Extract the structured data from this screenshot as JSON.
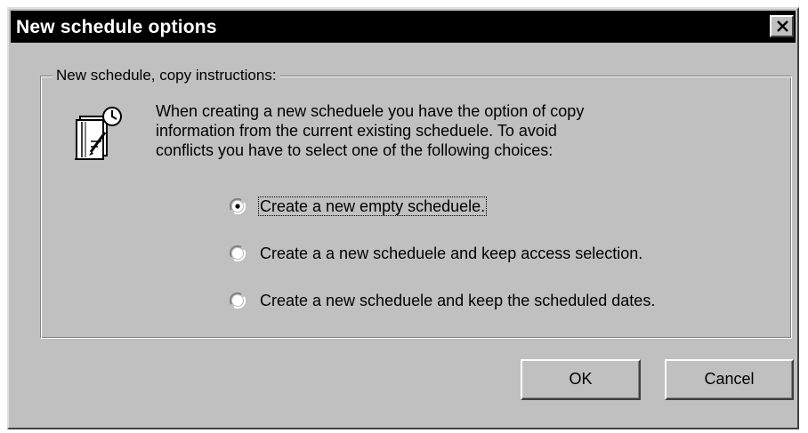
{
  "window": {
    "title": "New schedule options",
    "close_icon": "close-icon"
  },
  "group": {
    "legend": "New schedule, copy instructions:",
    "icon": "schedule-book-icon",
    "instructions": [
      "When creating a new scheduele you have the option of copy",
      "information from the current existing scheduele. To avoid",
      "conflicts you have to select one of the following choices:"
    ]
  },
  "options": [
    {
      "label": "Create a new empty scheduele.",
      "selected": true
    },
    {
      "label": "Create a a new scheduele and keep access selection.",
      "selected": false
    },
    {
      "label": "Create a new scheduele and keep the scheduled dates.",
      "selected": false
    }
  ],
  "buttons": {
    "ok_label": "OK",
    "cancel_label": "Cancel"
  }
}
